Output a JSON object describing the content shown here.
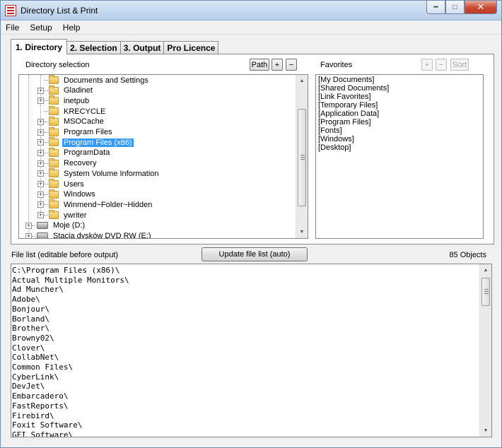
{
  "window": {
    "title": "Directory List & Print"
  },
  "menu": [
    "File",
    "Setup",
    "Help"
  ],
  "tabs": [
    {
      "label": "1. Directory",
      "active": true
    },
    {
      "label": "2. Selection"
    },
    {
      "label": "3. Output"
    },
    {
      "label": "Pro Licence"
    }
  ],
  "directory": {
    "label": "Directory selection",
    "buttons": {
      "path": "Path",
      "add": "+",
      "remove": "−"
    },
    "tree": [
      {
        "label": "Documents and Settings",
        "expandable": false
      },
      {
        "label": "Gladinet",
        "expandable": true
      },
      {
        "label": "inetpub",
        "expandable": true
      },
      {
        "label": "KRECYCLE",
        "expandable": false
      },
      {
        "label": "MSOCache",
        "expandable": true
      },
      {
        "label": "Program Files",
        "expandable": true
      },
      {
        "label": "Program Files (x86)",
        "expandable": true,
        "selected": true
      },
      {
        "label": "ProgramData",
        "expandable": true
      },
      {
        "label": "Recovery",
        "expandable": true
      },
      {
        "label": "System Volume Information",
        "expandable": true
      },
      {
        "label": "Users",
        "expandable": true
      },
      {
        "label": "Windows",
        "expandable": true
      },
      {
        "label": "Winmend~Folder~Hidden",
        "expandable": true
      },
      {
        "label": "ywriter",
        "expandable": true
      },
      {
        "label": "Moje (D:)",
        "expandable": true,
        "drive": true
      },
      {
        "label": "Stacja dysków DVD RW (E:)",
        "expandable": true,
        "drive": true
      }
    ]
  },
  "favorites": {
    "label": "Favorites",
    "buttons": {
      "add": "+",
      "remove": "−",
      "sort": "Sort"
    },
    "items": [
      "[My Documents]",
      "[Shared Documents]",
      "[Link Favorites]",
      "[Temporary Files]",
      "[Application Data]",
      "[Program Files]",
      "[Fonts]",
      "[Windows]",
      "[Desktop]"
    ]
  },
  "file_list": {
    "label": "File list (editable before output)",
    "update_button": "Update file list (auto)",
    "objects_count": "85 Objects",
    "lines": [
      "C:\\Program Files (x86)\\",
      "Actual Multiple Monitors\\",
      "Ad Muncher\\",
      "Adobe\\",
      "Bonjour\\",
      "Borland\\",
      "Brother\\",
      "Browny02\\",
      "Clover\\",
      "CollabNet\\",
      "Common Files\\",
      "CyberLink\\",
      "DevJet\\",
      "Embarcadero\\",
      "FastReports\\",
      "Firebird\\",
      "Foxit Software\\",
      "GFI Software\\"
    ]
  },
  "colors": {
    "selection": "#3399ff",
    "window_bg": "#f0f0f0",
    "titlebar": "#c3d7ee"
  }
}
